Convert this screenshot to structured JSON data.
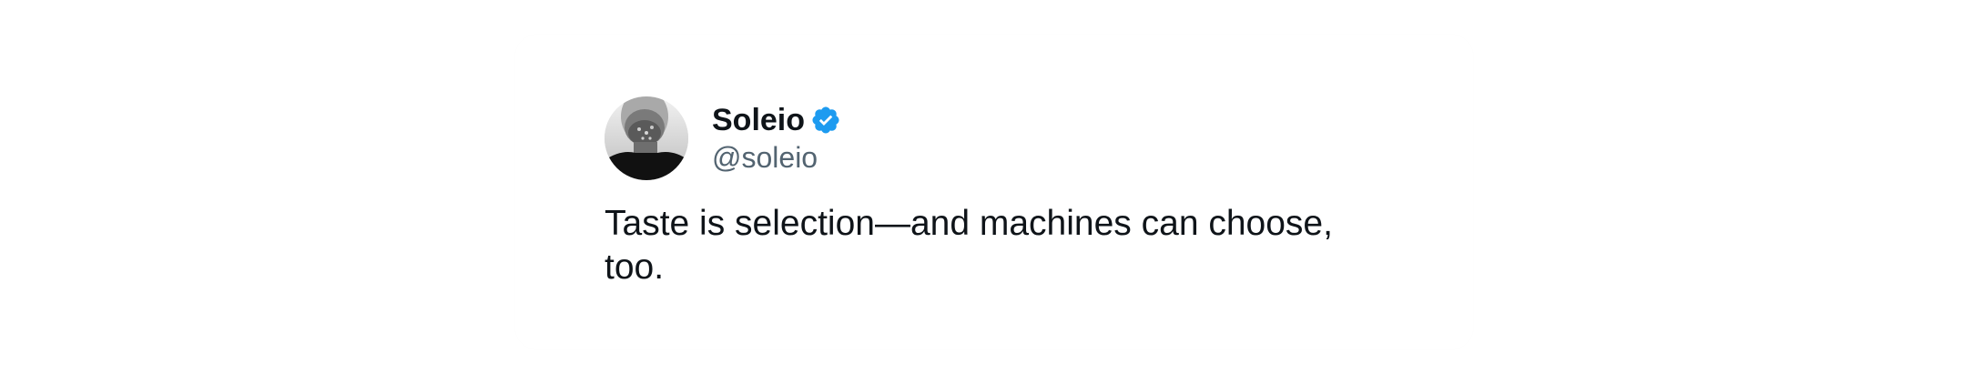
{
  "tweet": {
    "author": {
      "display_name": "Soleio",
      "handle": "@soleio",
      "verified": true,
      "verified_icon": "verified-badge-icon",
      "avatar": "profile-photo"
    },
    "text": "Taste is selection—and machines can choose, too."
  },
  "colors": {
    "text_primary": "#0f1419",
    "text_secondary": "#536471",
    "verified_blue": "#1d9bf0",
    "background": "#ffffff"
  }
}
